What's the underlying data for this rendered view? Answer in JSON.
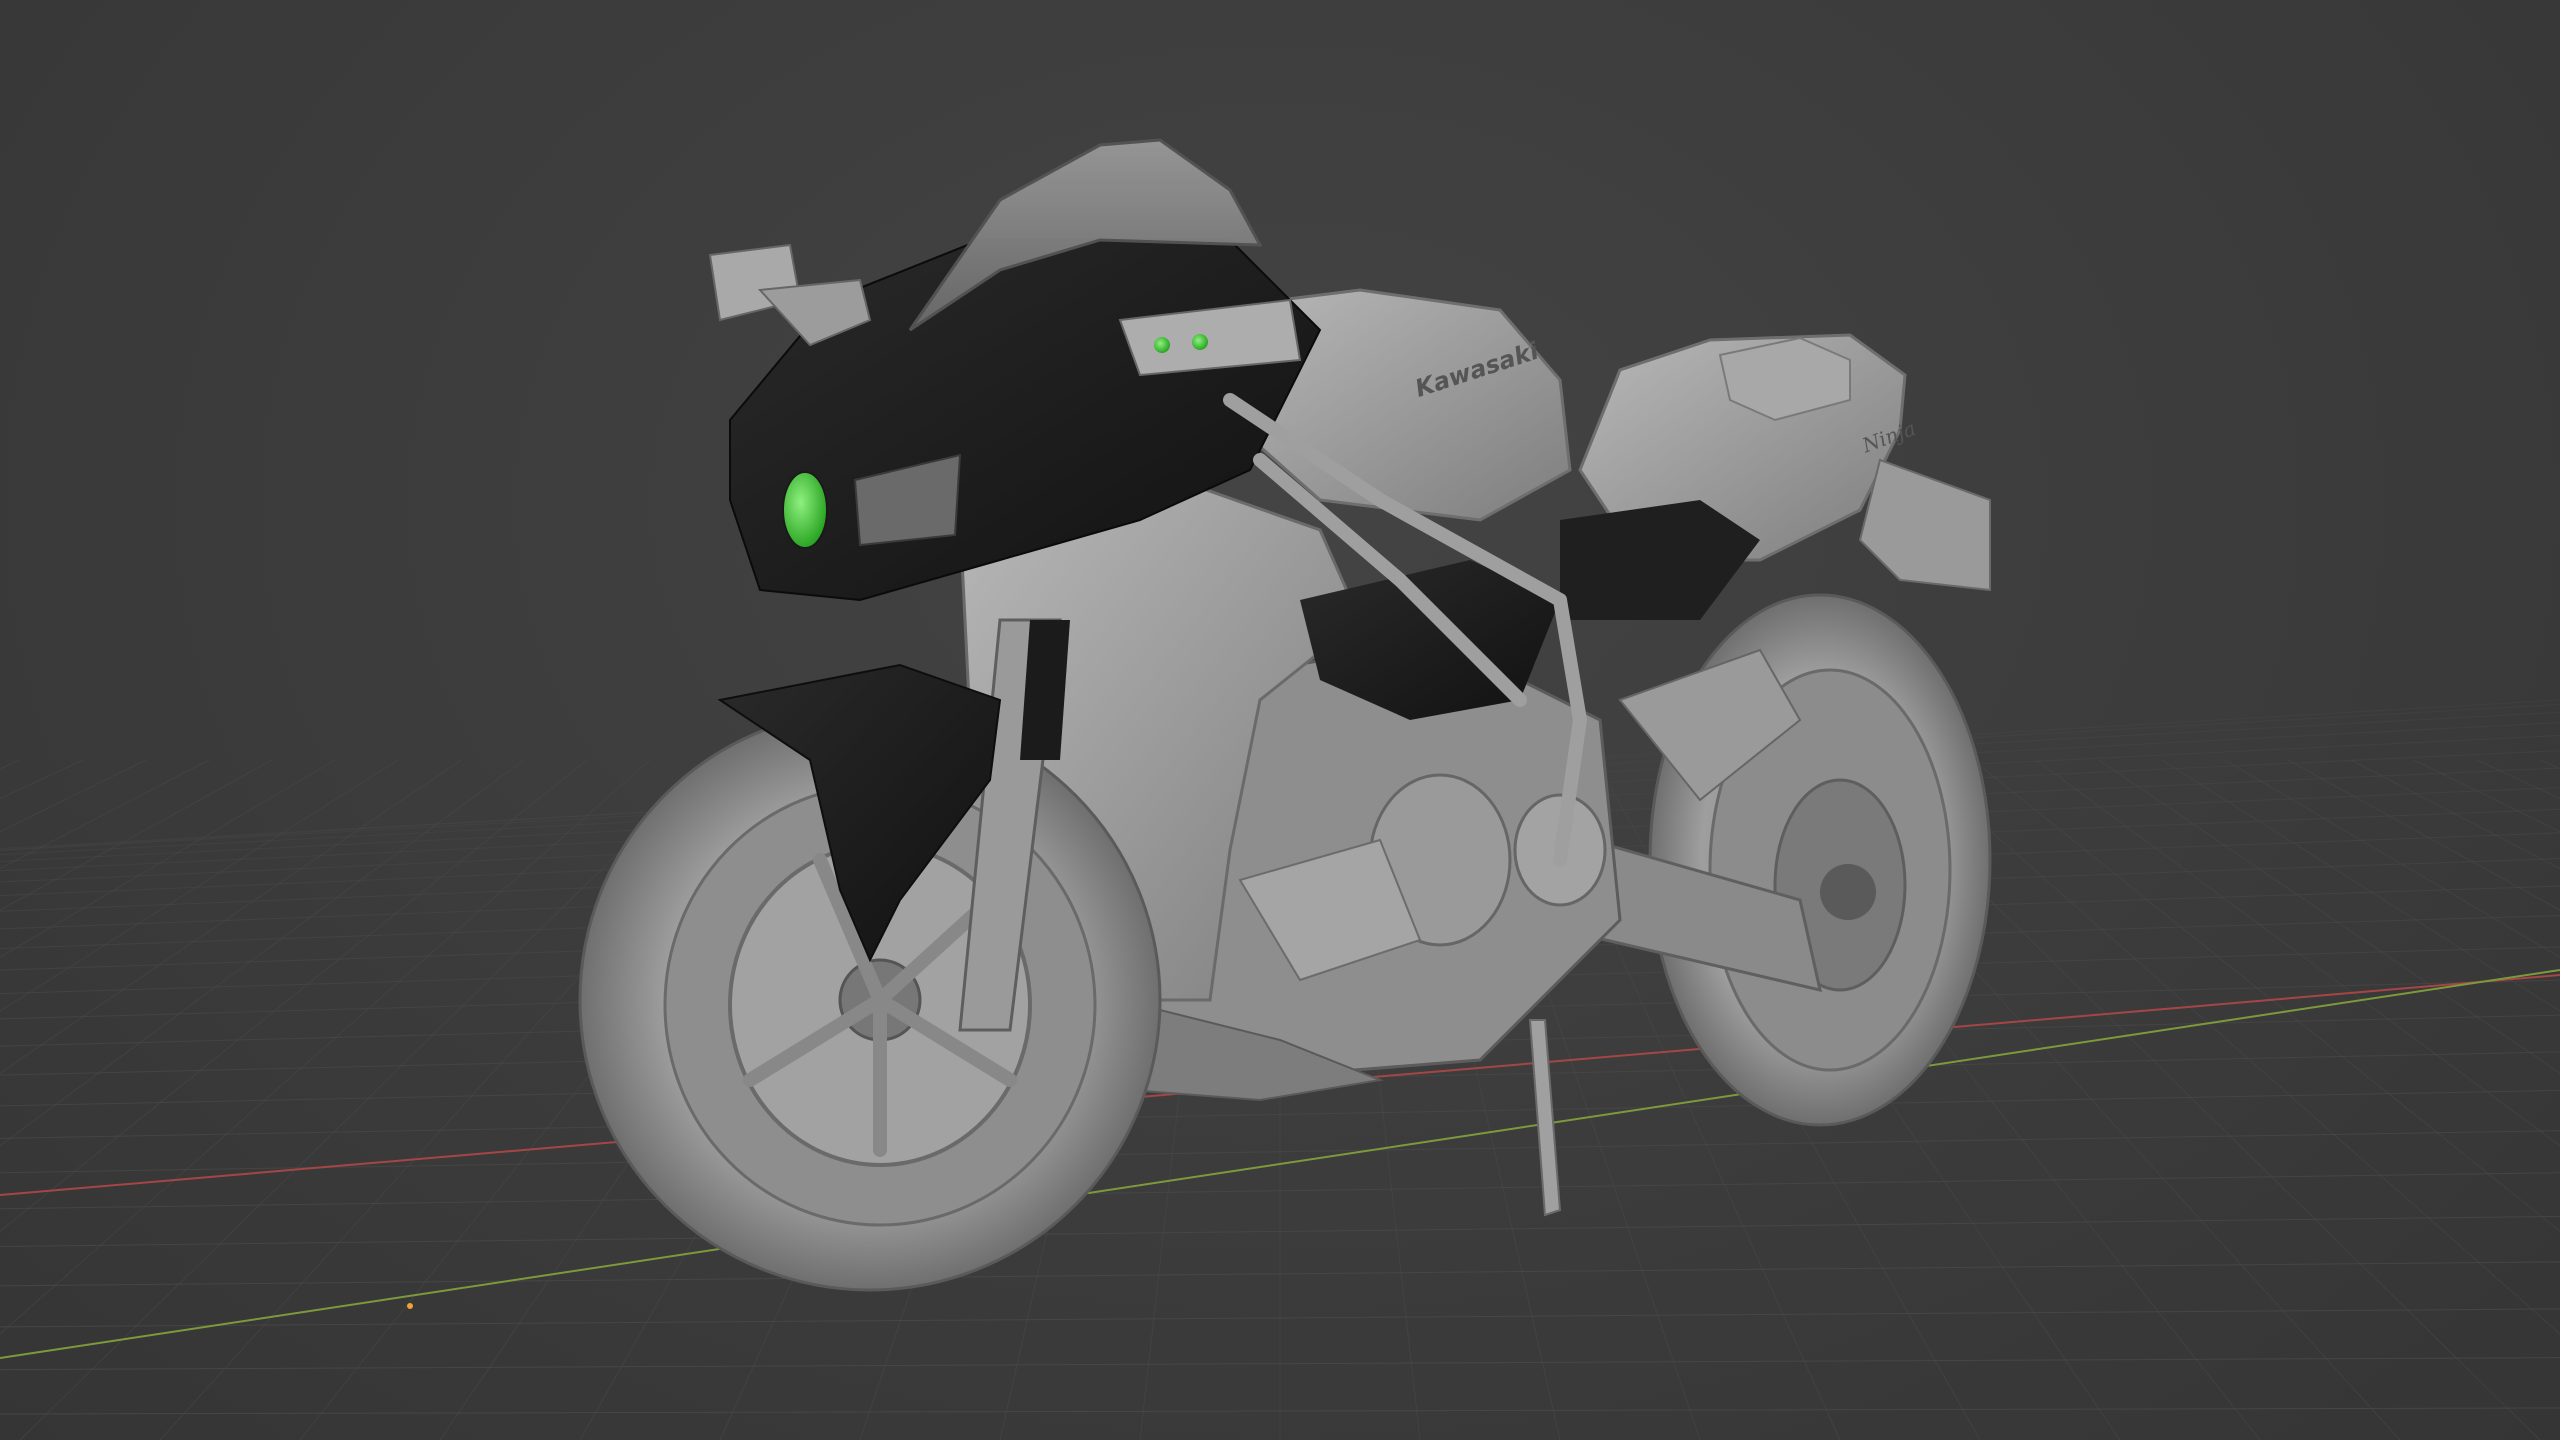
{
  "viewport": {
    "mode": "solid-shading",
    "background_color": "#3d3d3d",
    "grid_line_color": "#4a4a4a",
    "x_axis_color": "#a54646",
    "y_axis_color": "#7c9a3c",
    "origin_marker_color": "#f2a133"
  },
  "model": {
    "object": "motorcycle",
    "body_color": "#9c9c9c",
    "fairing_color": "#1c1c1c",
    "headlight_color": "#3fd23a",
    "brand_decal": "Kawasaki",
    "model_decal": "Ninja"
  }
}
